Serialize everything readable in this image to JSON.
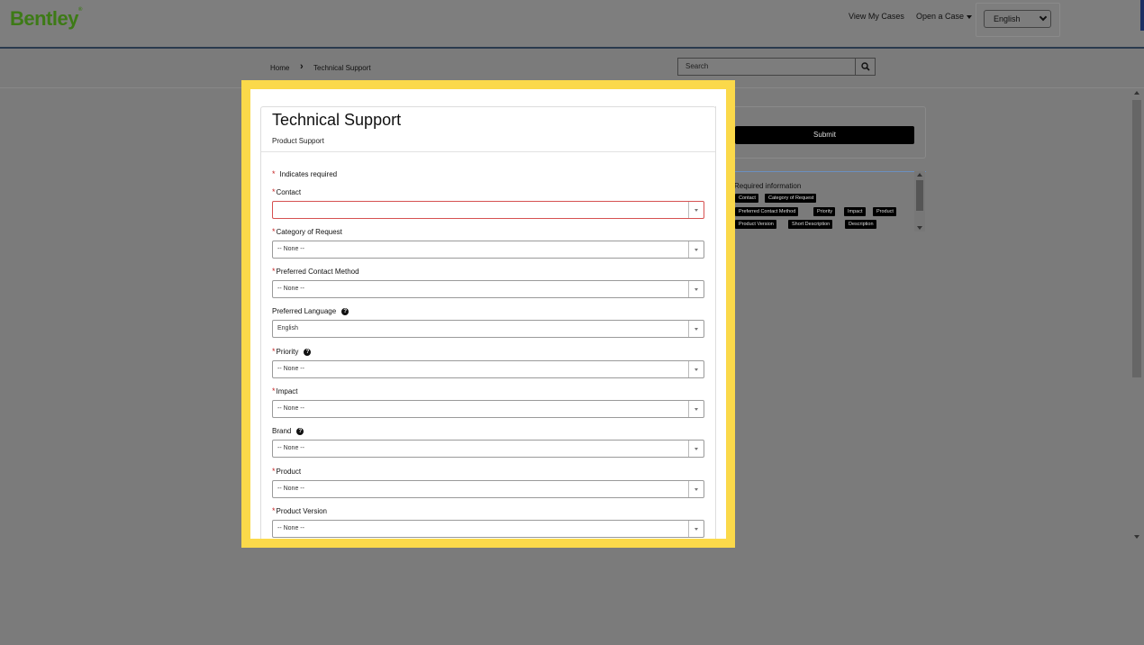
{
  "header": {
    "logo_text": "Bentley",
    "nav": {
      "view_cases": "View My Cases",
      "open_case": "Open a Case"
    },
    "language_selected": "English"
  },
  "breadcrumb": {
    "home": "Home",
    "separator": "›",
    "current": "Technical Support"
  },
  "search": {
    "placeholder": "Search"
  },
  "sidebar": {
    "submit_label": "Submit",
    "required_info_title": "Required information",
    "required_tags": [
      "Contact",
      "Category of Request",
      "Preferred Contact Method",
      "Priority",
      "Impact",
      "Product",
      "Product Version",
      "Short Description",
      "Description"
    ]
  },
  "form": {
    "title": "Technical Support",
    "subtitle": "Product Support",
    "required_note_star": "*",
    "required_note": "Indicates required",
    "fields": [
      {
        "label": "Contact",
        "required": true,
        "help": false,
        "value": "",
        "error": true
      },
      {
        "label": "Category of Request",
        "required": true,
        "help": false,
        "value": "-- None --"
      },
      {
        "label": "Preferred Contact Method",
        "required": true,
        "help": false,
        "value": "-- None --"
      },
      {
        "label": "Preferred Language",
        "required": false,
        "help": true,
        "value": "English"
      },
      {
        "label": "Priority",
        "required": true,
        "help": true,
        "value": "-- None --"
      },
      {
        "label": "Impact",
        "required": true,
        "help": false,
        "value": "-- None --"
      },
      {
        "label": "Brand",
        "required": false,
        "help": true,
        "value": "-- None --"
      },
      {
        "label": "Product",
        "required": true,
        "help": false,
        "value": "-- None --"
      },
      {
        "label": "Product Version",
        "required": true,
        "help": false,
        "value": "-- None --"
      }
    ]
  },
  "colors": {
    "highlight": "#fbd94a",
    "brand_green": "#3d7a16",
    "required_star": "#c62828",
    "error_border": "#d65151"
  }
}
